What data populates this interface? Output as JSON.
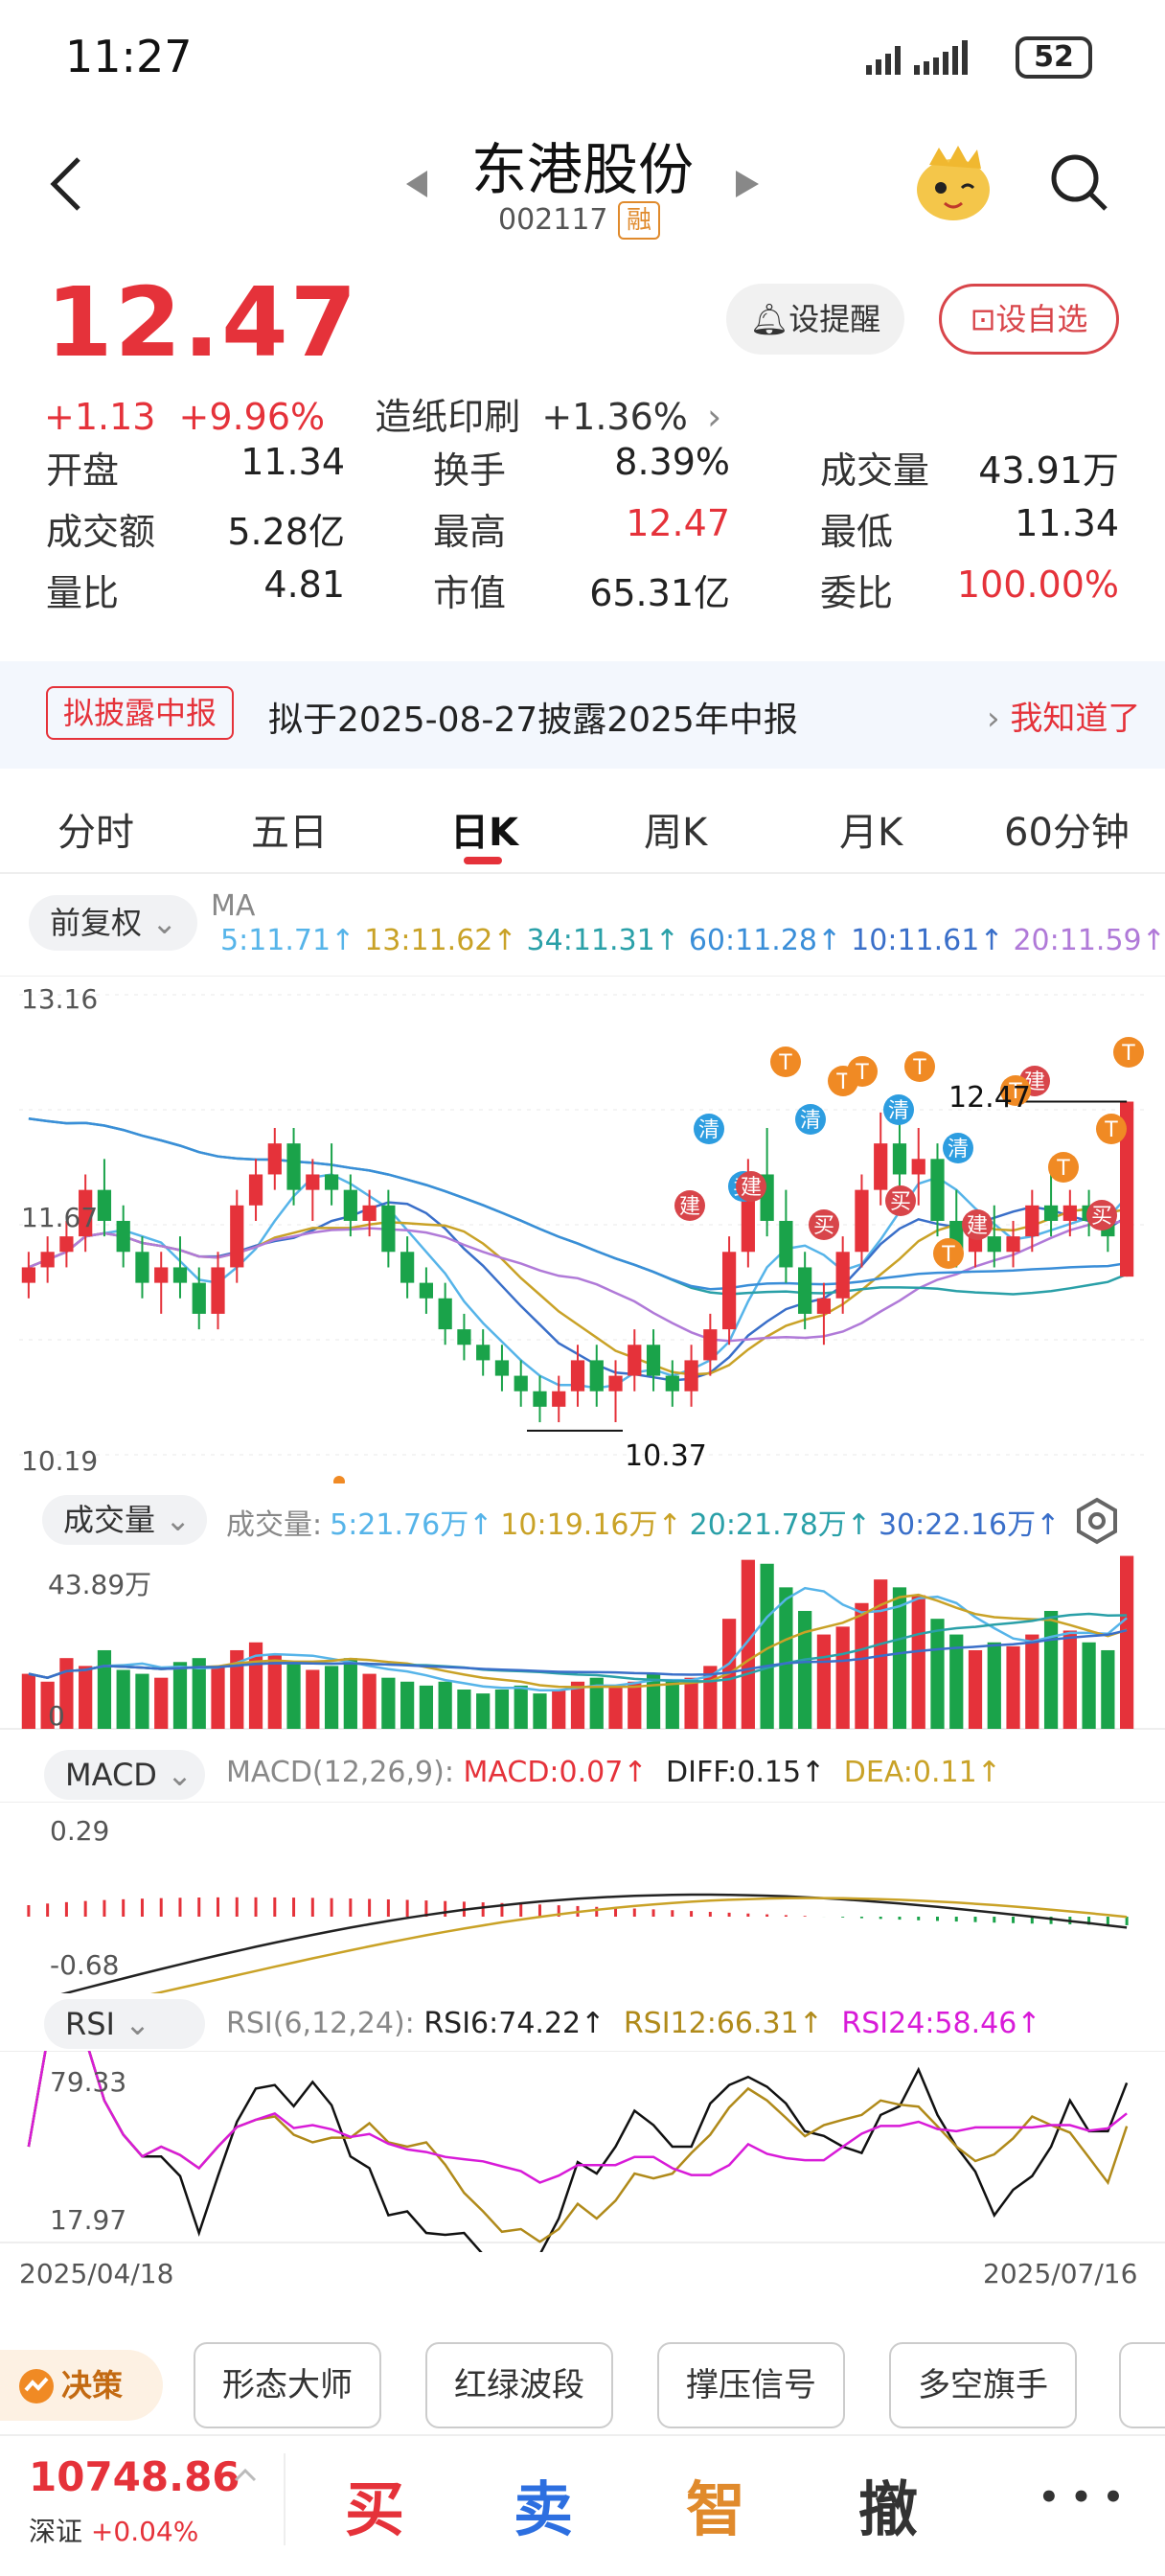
{
  "status": {
    "time": "11:27",
    "battery": "52"
  },
  "header": {
    "name": "东港股份",
    "code": "002117",
    "margin_tag": "融"
  },
  "quote": {
    "price": "12.47",
    "change": "+1.13",
    "change_pct": "+9.96%",
    "sector": "造纸印刷",
    "sector_pct": "+1.36%",
    "remind_label": "设提醒",
    "watch_label": "设自选"
  },
  "stats": [
    {
      "label": "开盘",
      "value": "11.34",
      "color": "#222222"
    },
    {
      "label": "换手",
      "value": "8.39%",
      "color": "#222222"
    },
    {
      "label": "成交量",
      "value": "43.91万",
      "color": "#222222"
    },
    {
      "label": "成交额",
      "value": "5.28亿",
      "color": "#222222"
    },
    {
      "label": "最高",
      "value": "12.47",
      "color": "#e5323a"
    },
    {
      "label": "最低",
      "value": "11.34",
      "color": "#222222"
    },
    {
      "label": "量比",
      "value": "4.81",
      "color": "#222222"
    },
    {
      "label": "市值",
      "value": "65.31亿",
      "color": "#222222"
    },
    {
      "label": "委比",
      "value": "100.00%",
      "color": "#e5323a"
    }
  ],
  "notice": {
    "tag": "拟披露中报",
    "text": "拟于2025-08-27披露2025年中报",
    "link": "我知道了"
  },
  "tabs": [
    "分时",
    "五日",
    "日K",
    "周K",
    "月K",
    "60分钟"
  ],
  "kline": {
    "adjust_label": "前复权",
    "ma_prefix": "MA",
    "ma_items": [
      {
        "text": "5:11.71↑",
        "color": "#56b4e9"
      },
      {
        "text": "13:11.62↑",
        "color": "#c9a227"
      },
      {
        "text": "34:11.31↑",
        "color": "#2aa0a8"
      },
      {
        "text": "60:11.28↑",
        "color": "#3a8ed8"
      },
      {
        "text": "10:11.61↑",
        "color": "#3a6fc9"
      },
      {
        "text": "20:11.59↑",
        "color": "#b07ad8"
      }
    ],
    "y_top": "13.16",
    "y_mid": "11.67",
    "y_bottom": "10.19",
    "high_label": "12.47",
    "low_label": "10.37",
    "markers": [
      "T",
      "清",
      "卖",
      "买",
      "建"
    ]
  },
  "volume": {
    "label": "成交量",
    "prefix": "成交量:",
    "items": [
      {
        "text": "5:21.76万↑",
        "color": "#56b4e9"
      },
      {
        "text": "10:19.16万↑",
        "color": "#c9a227"
      },
      {
        "text": "20:21.78万↑",
        "color": "#2aa0a8"
      },
      {
        "text": "30:22.16万↑",
        "color": "#3a6fc9"
      }
    ],
    "y_top": "43.89万",
    "y_bottom": "0"
  },
  "macd": {
    "label": "MACD",
    "params": "MACD(12,26,9):",
    "macd": "MACD:0.07↑",
    "diff": "DIFF:0.15↑",
    "dea": "DEA:0.11↑",
    "y_top": "0.29",
    "y_bottom": "-0.68"
  },
  "rsi": {
    "label": "RSI",
    "params": "RSI(6,12,24):",
    "rsi6": "RSI6:74.22↑",
    "rsi12": "RSI12:66.31↑",
    "rsi24": "RSI24:58.46↑",
    "y_top": "79.33",
    "y_bottom": "17.97"
  },
  "dates": {
    "start": "2025/04/18",
    "end": "2025/07/16"
  },
  "tools": {
    "decision": "决策",
    "chips": [
      "形态大师",
      "红绿波段",
      "撑压信号",
      "多空旗手"
    ]
  },
  "bottom": {
    "index_value": "10748.86",
    "index_name": "深证",
    "index_pct": "+0.04%",
    "buy": "买",
    "sell": "卖",
    "smart": "智",
    "cancel": "撤",
    "more": "• • •"
  },
  "chart_data": {
    "type": "candlestick",
    "candles": [
      [
        11.3,
        11.5,
        11.2,
        11.4
      ],
      [
        11.4,
        11.6,
        11.3,
        11.5
      ],
      [
        11.5,
        11.7,
        11.4,
        11.6
      ],
      [
        11.6,
        12.0,
        11.5,
        11.9
      ],
      [
        11.9,
        12.1,
        11.6,
        11.7
      ],
      [
        11.7,
        11.8,
        11.4,
        11.5
      ],
      [
        11.5,
        11.6,
        11.2,
        11.3
      ],
      [
        11.3,
        11.5,
        11.1,
        11.4
      ],
      [
        11.4,
        11.6,
        11.2,
        11.3
      ],
      [
        11.3,
        11.4,
        11.0,
        11.1
      ],
      [
        11.1,
        11.5,
        11.0,
        11.4
      ],
      [
        11.4,
        11.9,
        11.3,
        11.8
      ],
      [
        11.8,
        12.1,
        11.7,
        12.0
      ],
      [
        12.0,
        12.3,
        11.9,
        12.2
      ],
      [
        12.2,
        12.3,
        11.8,
        11.9
      ],
      [
        11.9,
        12.1,
        11.7,
        12.0
      ],
      [
        12.0,
        12.2,
        11.8,
        11.9
      ],
      [
        11.9,
        12.0,
        11.6,
        11.7
      ],
      [
        11.7,
        11.9,
        11.6,
        11.8
      ],
      [
        11.8,
        11.9,
        11.4,
        11.5
      ],
      [
        11.5,
        11.6,
        11.2,
        11.3
      ],
      [
        11.3,
        11.4,
        11.1,
        11.2
      ],
      [
        11.2,
        11.3,
        10.9,
        11.0
      ],
      [
        11.0,
        11.1,
        10.8,
        10.9
      ],
      [
        10.9,
        11.0,
        10.7,
        10.8
      ],
      [
        10.8,
        10.9,
        10.6,
        10.7
      ],
      [
        10.7,
        10.8,
        10.5,
        10.6
      ],
      [
        10.6,
        10.7,
        10.4,
        10.5
      ],
      [
        10.5,
        10.7,
        10.4,
        10.6
      ],
      [
        10.6,
        10.9,
        10.5,
        10.8
      ],
      [
        10.8,
        10.9,
        10.5,
        10.6
      ],
      [
        10.6,
        10.8,
        10.4,
        10.7
      ],
      [
        10.7,
        11.0,
        10.6,
        10.9
      ],
      [
        10.9,
        11.0,
        10.6,
        10.7
      ],
      [
        10.7,
        10.8,
        10.5,
        10.6
      ],
      [
        10.6,
        10.9,
        10.5,
        10.8
      ],
      [
        10.8,
        11.1,
        10.7,
        11.0
      ],
      [
        11.0,
        11.6,
        10.9,
        11.5
      ],
      [
        11.5,
        12.1,
        11.4,
        12.0
      ],
      [
        12.0,
        12.3,
        11.6,
        11.7
      ],
      [
        11.7,
        11.9,
        11.3,
        11.4
      ],
      [
        11.4,
        11.5,
        11.0,
        11.1
      ],
      [
        11.1,
        11.3,
        10.9,
        11.2
      ],
      [
        11.2,
        11.6,
        11.1,
        11.5
      ],
      [
        11.5,
        12.0,
        11.4,
        11.9
      ],
      [
        11.9,
        12.4,
        11.8,
        12.2
      ],
      [
        12.2,
        12.4,
        11.9,
        12.0
      ],
      [
        12.0,
        12.3,
        11.8,
        12.1
      ],
      [
        12.1,
        12.2,
        11.6,
        11.7
      ],
      [
        11.7,
        11.9,
        11.4,
        11.5
      ],
      [
        11.5,
        11.7,
        11.4,
        11.6
      ],
      [
        11.6,
        11.8,
        11.4,
        11.5
      ],
      [
        11.5,
        11.7,
        11.4,
        11.6
      ],
      [
        11.6,
        11.9,
        11.5,
        11.8
      ],
      [
        11.8,
        12.0,
        11.6,
        11.7
      ],
      [
        11.7,
        11.9,
        11.6,
        11.8
      ],
      [
        11.8,
        11.9,
        11.6,
        11.7
      ],
      [
        11.7,
        11.8,
        11.5,
        11.6
      ],
      [
        11.34,
        12.47,
        11.34,
        12.47
      ]
    ],
    "volume": [
      14,
      12,
      18,
      16,
      20,
      15,
      14,
      13,
      17,
      18,
      16,
      20,
      22,
      19,
      17,
      15,
      16,
      18,
      14,
      13,
      12,
      11,
      12,
      10,
      9,
      10,
      11,
      9,
      10,
      12,
      13,
      11,
      12,
      14,
      12,
      13,
      16,
      28,
      43,
      42,
      36,
      30,
      24,
      26,
      32,
      38,
      36,
      34,
      28,
      24,
      20,
      22,
      21,
      24,
      30,
      25,
      22,
      20,
      44
    ],
    "ylim": [
      10.19,
      13.16
    ],
    "volume_max": 43.89
  }
}
